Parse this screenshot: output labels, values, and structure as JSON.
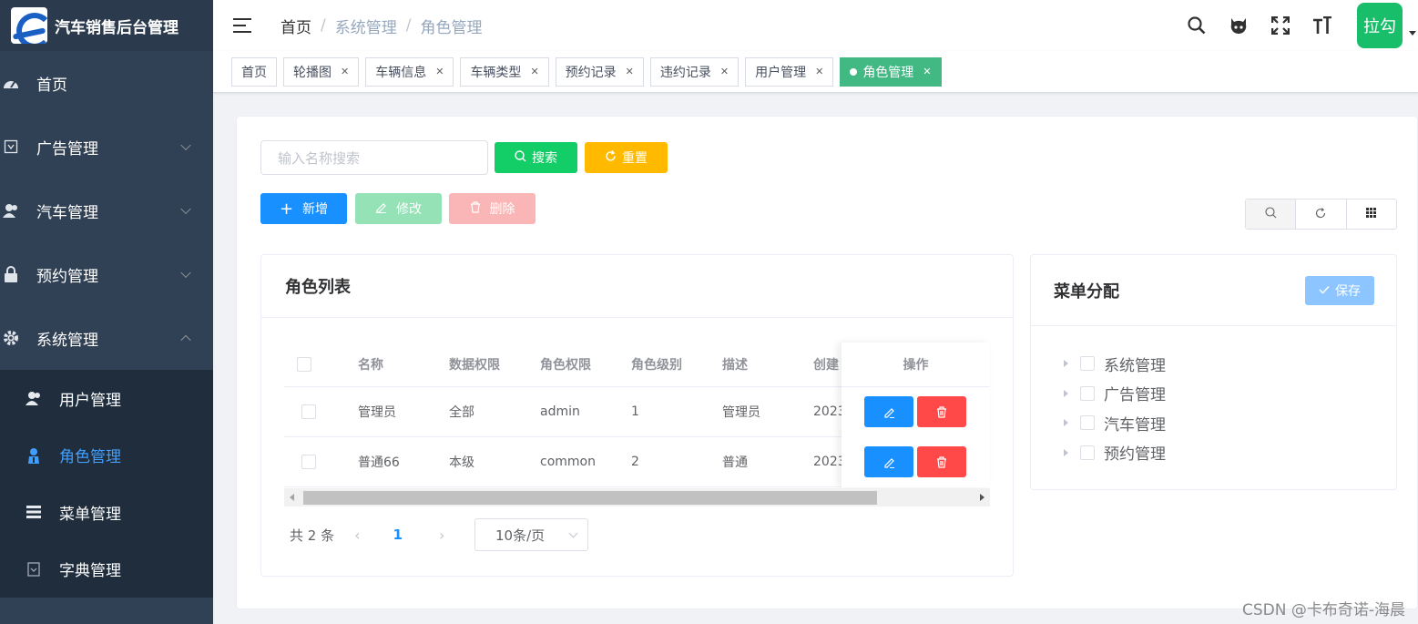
{
  "app": {
    "title": "汽车销售后台管理"
  },
  "sidebar": {
    "items": [
      {
        "label": "首页",
        "icon": "dashboard-icon"
      },
      {
        "label": "广告管理",
        "icon": "ad-icon"
      },
      {
        "label": "汽车管理",
        "icon": "user-group-icon"
      },
      {
        "label": "预约管理",
        "icon": "lock-icon"
      },
      {
        "label": "系统管理",
        "icon": "gear-icon"
      }
    ],
    "submenu": [
      {
        "label": "用户管理",
        "icon": "users-icon"
      },
      {
        "label": "角色管理",
        "icon": "role-icon",
        "active": true
      },
      {
        "label": "菜单管理",
        "icon": "list-icon"
      },
      {
        "label": "字典管理",
        "icon": "dict-icon"
      }
    ]
  },
  "header": {
    "breadcrumb": [
      "首页",
      "系统管理",
      "角色管理"
    ],
    "avatar_text": "拉勾",
    "icons": [
      "search-icon",
      "github-icon",
      "fullscreen-icon",
      "font-size-icon"
    ]
  },
  "tags": [
    {
      "label": "首页",
      "closable": false
    },
    {
      "label": "轮播图",
      "closable": true
    },
    {
      "label": "车辆信息",
      "closable": true
    },
    {
      "label": "车辆类型",
      "closable": true
    },
    {
      "label": "预约记录",
      "closable": true
    },
    {
      "label": "违约记录",
      "closable": true
    },
    {
      "label": "用户管理",
      "closable": true
    },
    {
      "label": "角色管理",
      "closable": true,
      "active": true
    }
  ],
  "toolbar": {
    "search_placeholder": "输入名称搜索",
    "search_label": "搜索",
    "reset_label": "重置",
    "add_label": "新增",
    "edit_label": "修改",
    "delete_label": "删除"
  },
  "role_list": {
    "title": "角色列表",
    "columns": [
      "名称",
      "数据权限",
      "角色权限",
      "角色级别",
      "描述",
      "创建",
      "操作"
    ],
    "rows": [
      {
        "name": "管理员",
        "data_scope": "全部",
        "permission": "admin",
        "level": "1",
        "description": "管理员",
        "created": "2023"
      },
      {
        "name": "普通66",
        "data_scope": "本级",
        "permission": "common",
        "level": "2",
        "description": "普通",
        "created": "2023"
      }
    ]
  },
  "pagination": {
    "total_label": "共 2 条",
    "current_page": "1",
    "page_size": "10条/页"
  },
  "menu_assign": {
    "title": "菜单分配",
    "save_label": "保存",
    "tree": [
      "系统管理",
      "广告管理",
      "汽车管理",
      "预约管理"
    ]
  },
  "colors": {
    "sidebar_bg": "#304156",
    "active_tag": "#42b983",
    "primary": "#1890ff",
    "success": "#13ce66",
    "warning": "#ffba00",
    "danger": "#ff4949"
  },
  "watermark": "CSDN @卡布奇诺-海晨"
}
